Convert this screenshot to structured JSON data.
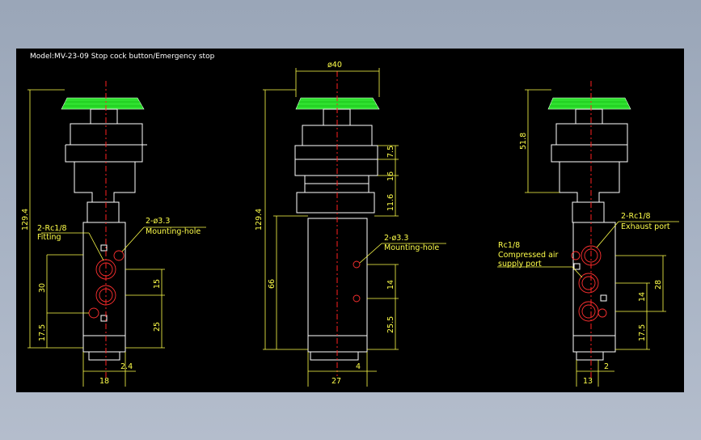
{
  "title": "Model:MV-23-09 Stop cock button/Emergency stop",
  "colors": {
    "background": "#a9b4c5",
    "sheet": "#000000",
    "outline": "#ffffff",
    "dimension": "#ffff4a",
    "center": "#ff2020",
    "button": "#2fe02f"
  },
  "front": {
    "height_total": "129.4",
    "port_label_1": "2-Rc1/8",
    "port_label_2": "Fitting",
    "hole_label_1": "2-ø3.3",
    "hole_label_2": "Mounting-hole",
    "dim_30": "30",
    "dim_17_5": "17.5",
    "dim_15": "15",
    "dim_25": "25",
    "width": "18",
    "offset": "2.4"
  },
  "side": {
    "dia": "ø40",
    "height_total": "129.4",
    "height_66": "66",
    "dim_7_5": "7.5",
    "dim_16": "16",
    "dim_11_6": "11.6",
    "hole_label_1": "2-ø3.3",
    "hole_label_2": "Mounting-hole",
    "dim_14": "14",
    "dim_25_5": "25.5",
    "width": "27",
    "offset": "4"
  },
  "back": {
    "height_51_8": "51.8",
    "port_label_1": "2-Rc1/8",
    "port_label_2": "Exhaust port",
    "supply_1": "Rc1/8",
    "supply_2": "Compressed air",
    "supply_3": "supply port",
    "dim_28": "28",
    "dim_14": "14",
    "dim_17_5": "17.5",
    "width": "13",
    "offset": "2"
  }
}
